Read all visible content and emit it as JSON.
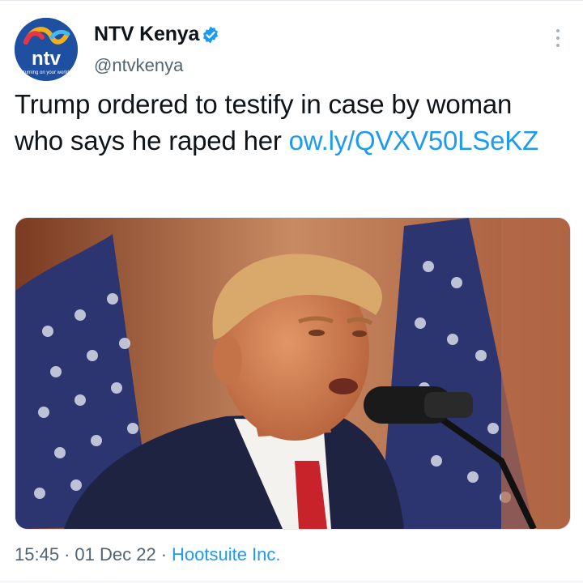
{
  "author": {
    "display_name": "NTV Kenya",
    "handle": "@ntvkenya",
    "avatar_logo_text": "ntv",
    "avatar_tagline": "turning on your world",
    "verified": true
  },
  "tweet": {
    "text": "Trump ordered to testify in case by woman who says he raped her ",
    "link_text": "ow.ly/QVXV50LSeKZ"
  },
  "media": {
    "description_icon": "photo-of-speaker-at-microphone"
  },
  "meta": {
    "time": "15:45",
    "separator": "·",
    "date": "01 Dec 22",
    "source": "Hootsuite Inc."
  },
  "colors": {
    "link": "#1d9bf0",
    "secondary_text": "#536471",
    "avatar_bg": "#1f4fa0"
  }
}
